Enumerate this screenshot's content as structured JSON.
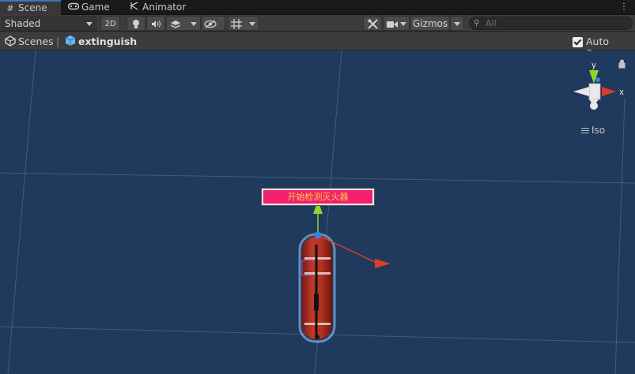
{
  "tabs": [
    {
      "label": "Scene",
      "icon": "grid-icon",
      "active": true
    },
    {
      "label": "Game",
      "icon": "gamepad-icon",
      "active": false
    },
    {
      "label": "Animator",
      "icon": "animator-icon",
      "active": false
    }
  ],
  "toolbar": {
    "shading_mode": "Shaded",
    "mode_2d": "2D",
    "hidden_count": "0",
    "gizmos_label": "Gizmos",
    "search_placeholder": "All"
  },
  "breadcrumb": {
    "root": "Scenes",
    "current": "extinguish",
    "autosave_label": "Auto Save",
    "autosave_checked": true
  },
  "viewport": {
    "banner_text": "开始检测灭火器",
    "gizmo_y_label": "y",
    "gizmo_x_label": "x",
    "projection_label": "Iso"
  },
  "colors": {
    "viewport_bg": "#1f3a5c",
    "banner_bg": "#f2206e",
    "banner_text": "#ffd23a",
    "axis_x": "#e03a2a",
    "axis_y": "#8fd62a",
    "axis_z": "#3a7fe8",
    "active_tab_accent": "#3a79bb"
  }
}
